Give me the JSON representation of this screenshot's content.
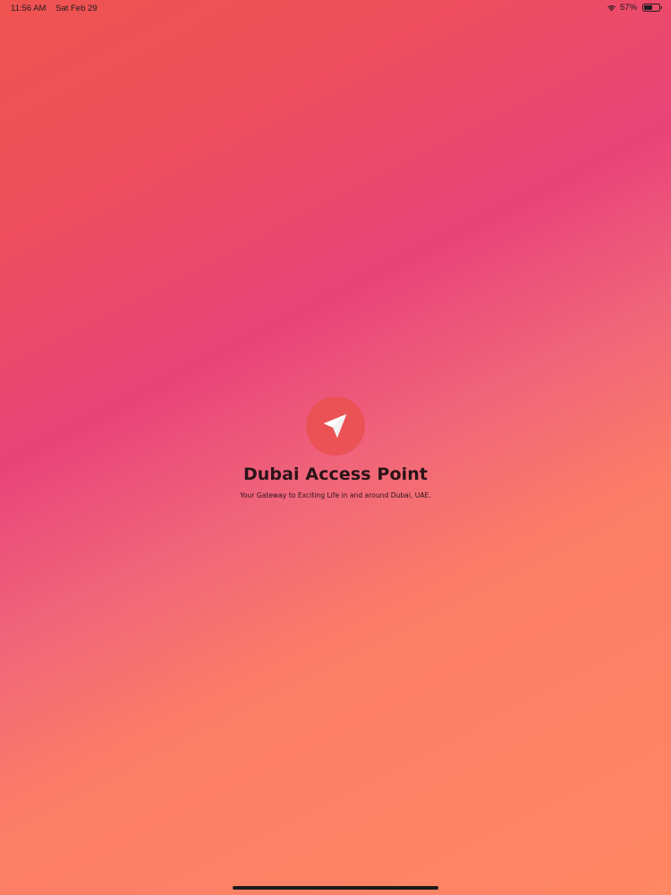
{
  "status_bar": {
    "time": "11:56 AM",
    "date": "Sat Feb 29",
    "battery_percent": "57%",
    "battery_level": 0.57,
    "wifi_icon": "wifi-icon",
    "battery_icon": "battery-icon"
  },
  "splash": {
    "logo_icon": "paper-plane-icon",
    "title": "Dubai Access Point",
    "tagline": "Your Gateway to Exciting Life in and around Dubai, UAE."
  },
  "colors": {
    "gradient_top": "#ef5350",
    "gradient_middle": "#e9447a",
    "gradient_bottom": "#fe8764",
    "logo_circle": "#ea5256",
    "text": "#2a1418"
  }
}
